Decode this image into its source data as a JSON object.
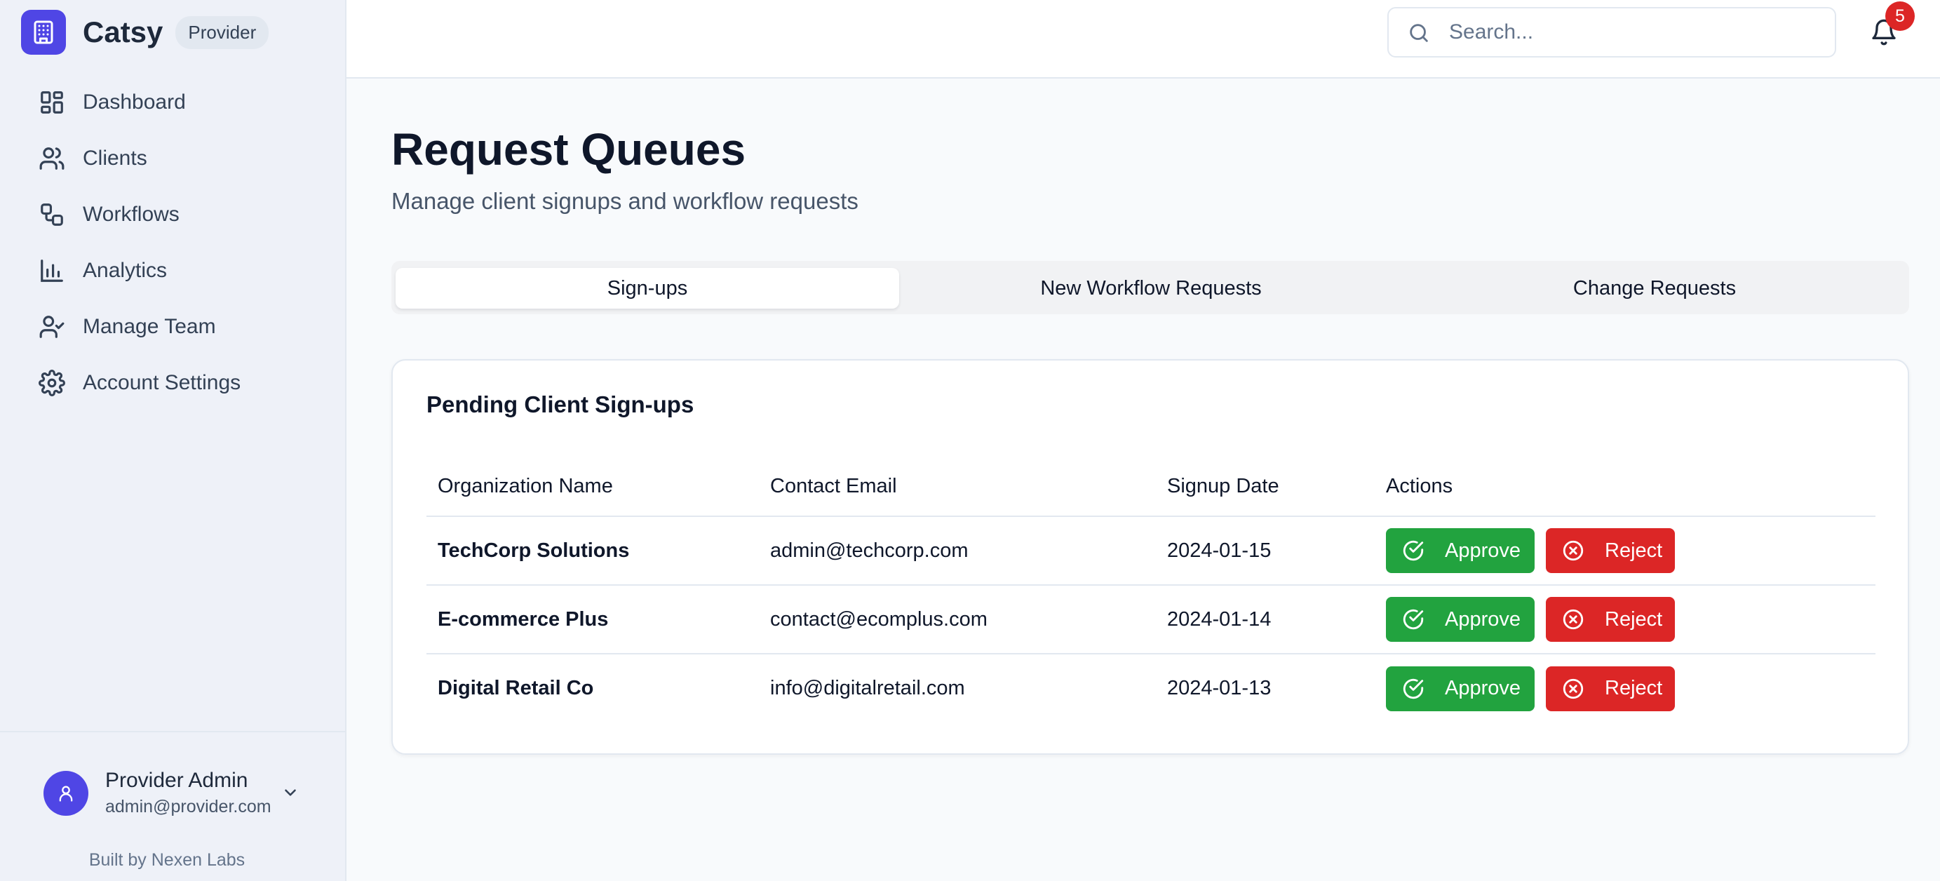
{
  "brand": {
    "name": "Catsy",
    "badge": "Provider"
  },
  "sidebar": {
    "items": [
      {
        "label": "Dashboard",
        "icon": "dashboard-icon"
      },
      {
        "label": "Clients",
        "icon": "users-icon"
      },
      {
        "label": "Workflows",
        "icon": "workflow-icon"
      },
      {
        "label": "Analytics",
        "icon": "bar-chart-icon"
      },
      {
        "label": "Manage Team",
        "icon": "user-check-icon"
      },
      {
        "label": "Account Settings",
        "icon": "gear-icon"
      }
    ]
  },
  "user": {
    "name": "Provider Admin",
    "email": "admin@provider.com"
  },
  "footer": {
    "built_by": "Built by Nexen Labs"
  },
  "topbar": {
    "search_placeholder": "Search...",
    "notification_count": "5"
  },
  "page": {
    "title": "Request Queues",
    "subtitle": "Manage client signups and workflow requests"
  },
  "tabs": [
    {
      "label": "Sign-ups",
      "active": true
    },
    {
      "label": "New Workflow Requests",
      "active": false
    },
    {
      "label": "Change Requests",
      "active": false
    }
  ],
  "card": {
    "title": "Pending Client Sign-ups",
    "columns": [
      "Organization Name",
      "Contact Email",
      "Signup Date",
      "Actions"
    ],
    "rows": [
      {
        "org": "TechCorp Solutions",
        "email": "admin@techcorp.com",
        "date": "2024-01-15"
      },
      {
        "org": "E-commerce Plus",
        "email": "contact@ecomplus.com",
        "date": "2024-01-14"
      },
      {
        "org": "Digital Retail Co",
        "email": "info@digitalretail.com",
        "date": "2024-01-13"
      }
    ],
    "approve_label": "Approve",
    "reject_label": "Reject"
  },
  "colors": {
    "accent": "#4f46e5",
    "approve": "#22a33f",
    "reject": "#dc2626",
    "badge": "#dc2626"
  }
}
